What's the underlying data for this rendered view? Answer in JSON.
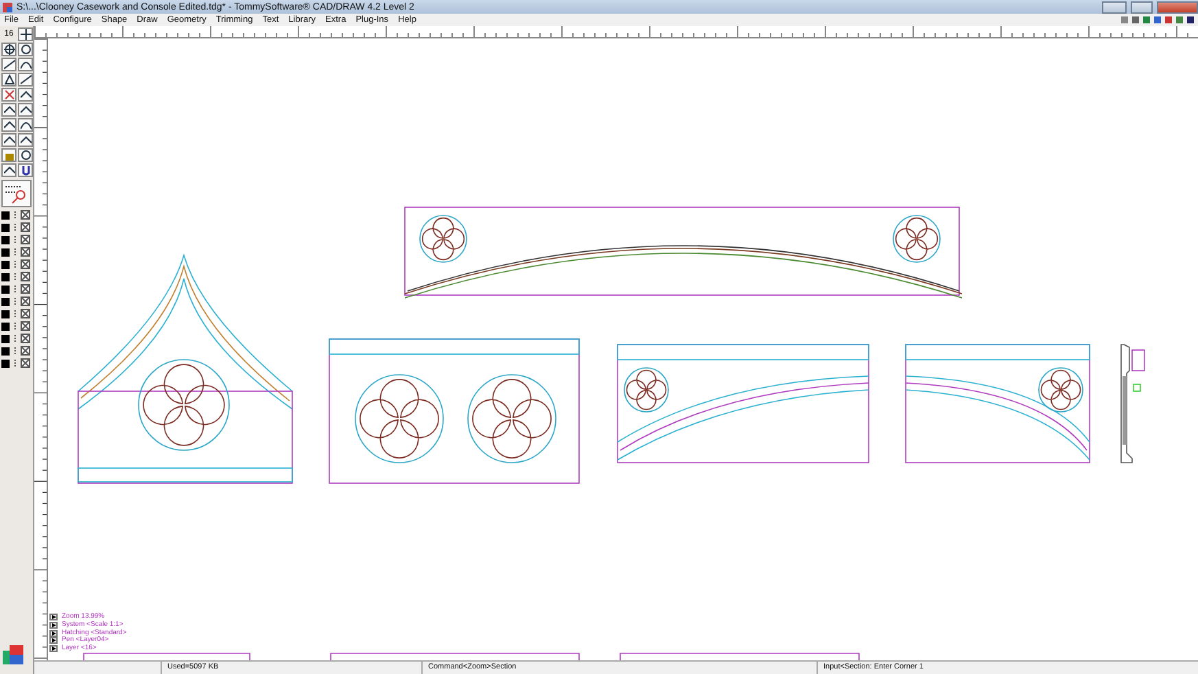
{
  "window": {
    "title": "S:\\...\\Clooney Casework and Console Edited.tdg* - TommySoftware® CAD/DRAW 4.2 Level 2"
  },
  "menu": [
    "File",
    "Edit",
    "Configure",
    "Shape",
    "Draw",
    "Geometry",
    "Trimming",
    "Text",
    "Library",
    "Extra",
    "Plug-Ins",
    "Help"
  ],
  "toolbar": {
    "grid_size": "16"
  },
  "info_lines": [
    "Zoom 13.99%",
    "System <Scale 1:1>",
    "Hatching <Standard>",
    "Pen <Layer04>",
    "Layer <16>"
  ],
  "status_bar": {
    "memory": "Used=5097 KB",
    "command": "Command<Zoom>Section",
    "input": "Input<Section: Enter Corner 1"
  }
}
